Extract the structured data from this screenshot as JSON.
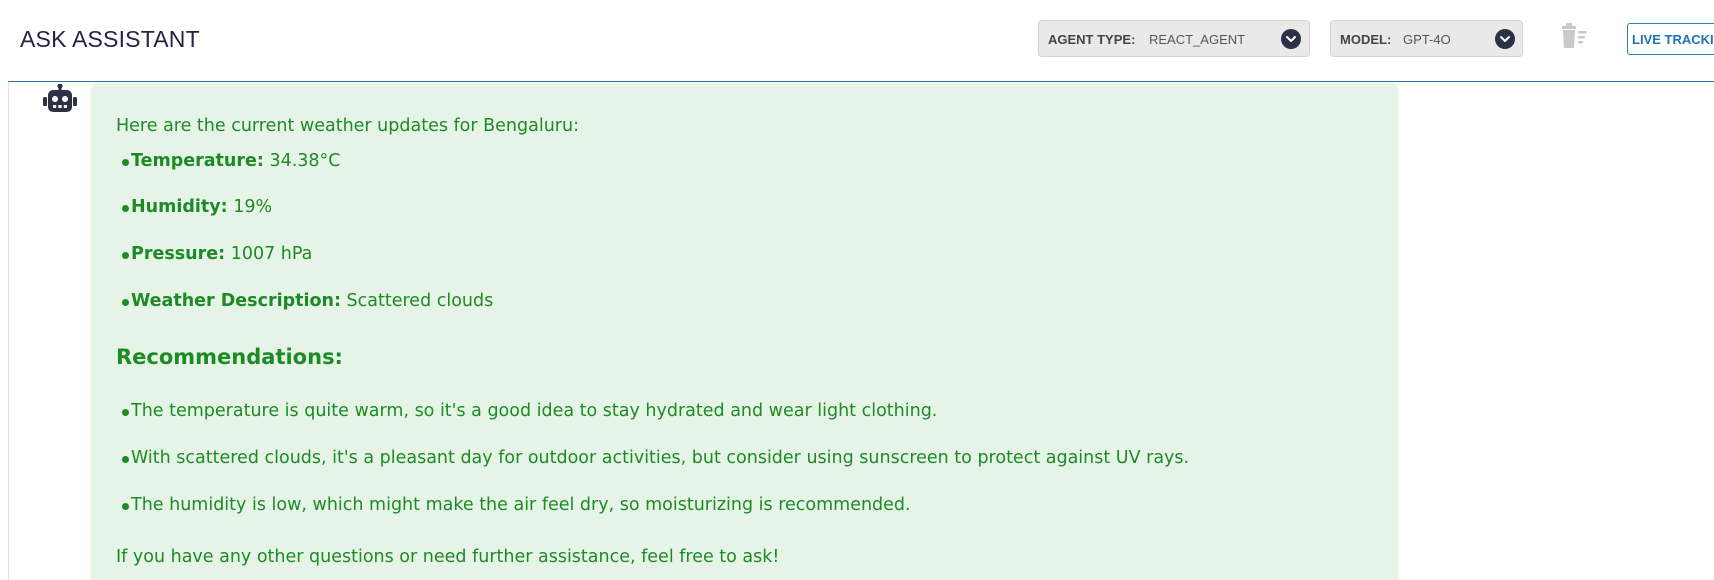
{
  "header": {
    "title": "ASK ASSISTANT",
    "agent_type": {
      "label": "AGENT TYPE:",
      "value": "REACT_AGENT"
    },
    "model": {
      "label": "MODEL:",
      "value": "GPT-4O"
    },
    "clear_icon": "clear-all-icon",
    "live_tracking_label": "LIVE TRACKIN"
  },
  "colors": {
    "bubble_background": "#e6f4e7",
    "message_text": "#1e8a26",
    "accent_blue": "#1f73b7",
    "chevron_badge": "#2d3146"
  },
  "message": {
    "avatar_icon": "robot-icon",
    "intro": "Here are the current weather updates for Bengaluru:",
    "stats": [
      {
        "label": "Temperature:",
        "value": "34.38°C"
      },
      {
        "label": "Humidity:",
        "value": "19%"
      },
      {
        "label": "Pressure:",
        "value": "1007 hPa"
      },
      {
        "label": "Weather Description:",
        "value": "Scattered clouds"
      }
    ],
    "recommendations_heading": "Recommendations:",
    "recommendations": [
      "The temperature is quite warm, so it's a good idea to stay hydrated and wear light clothing.",
      "With scattered clouds, it's a pleasant day for outdoor activities, but consider using sunscreen to protect against UV rays.",
      "The humidity is low, which might make the air feel dry, so moisturizing is recommended."
    ],
    "closing": "If you have any other questions or need further assistance, feel free to ask!"
  }
}
